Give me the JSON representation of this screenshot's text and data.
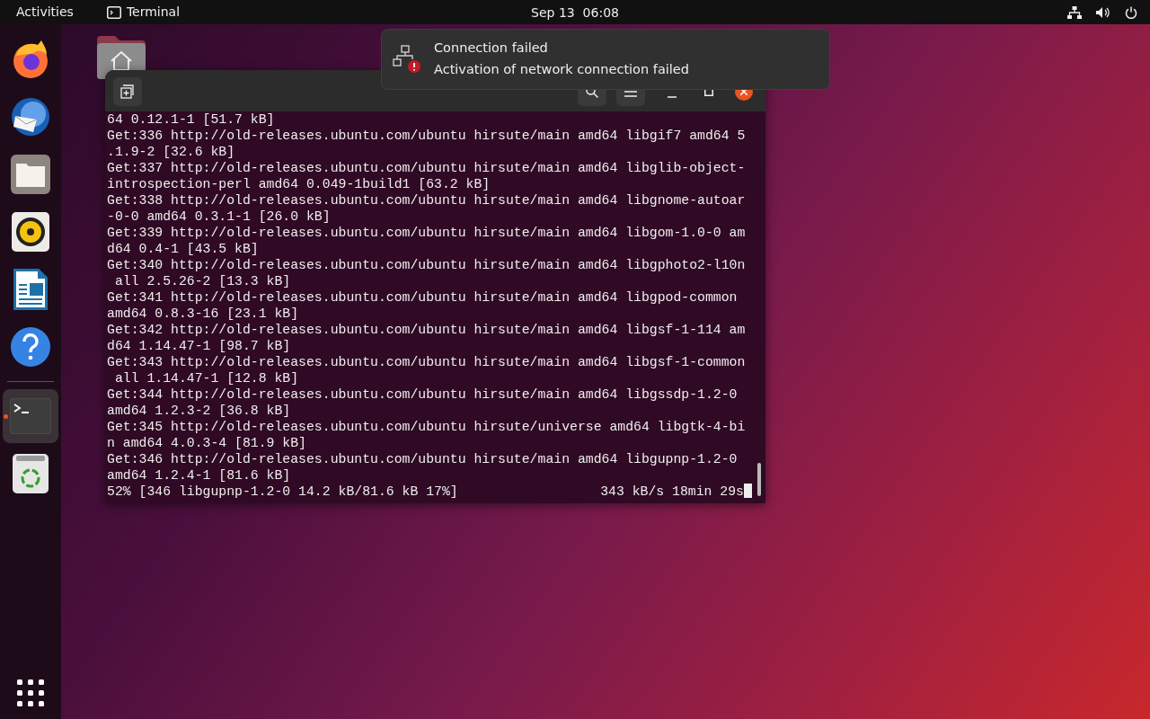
{
  "top_bar": {
    "activities": "Activities",
    "app_name": "Terminal",
    "clock": "Sep 13  06:08"
  },
  "dock": {
    "items": [
      {
        "kind": "browser",
        "running": false
      },
      {
        "kind": "mail",
        "running": false
      },
      {
        "kind": "files",
        "running": false
      },
      {
        "kind": "music",
        "running": false
      },
      {
        "kind": "writer",
        "running": false
      },
      {
        "kind": "help",
        "running": false
      },
      {
        "kind": "terminal",
        "running": true
      },
      {
        "kind": "trash",
        "running": false
      }
    ]
  },
  "notification": {
    "title": "Connection failed",
    "body": "Activation of network connection failed"
  },
  "terminal": {
    "lines": [
      "64 0.12.1-1 [51.7 kB]",
      "Get:336 http://old-releases.ubuntu.com/ubuntu hirsute/main amd64 libgif7 amd64 5",
      ".1.9-2 [32.6 kB]",
      "Get:337 http://old-releases.ubuntu.com/ubuntu hirsute/main amd64 libglib-object-",
      "introspection-perl amd64 0.049-1build1 [63.2 kB]",
      "Get:338 http://old-releases.ubuntu.com/ubuntu hirsute/main amd64 libgnome-autoar",
      "-0-0 amd64 0.3.1-1 [26.0 kB]",
      "Get:339 http://old-releases.ubuntu.com/ubuntu hirsute/main amd64 libgom-1.0-0 am",
      "d64 0.4-1 [43.5 kB]",
      "Get:340 http://old-releases.ubuntu.com/ubuntu hirsute/main amd64 libgphoto2-l10n",
      " all 2.5.26-2 [13.3 kB]",
      "Get:341 http://old-releases.ubuntu.com/ubuntu hirsute/main amd64 libgpod-common",
      "amd64 0.8.3-16 [23.1 kB]",
      "Get:342 http://old-releases.ubuntu.com/ubuntu hirsute/main amd64 libgsf-1-114 am",
      "d64 1.14.47-1 [98.7 kB]",
      "Get:343 http://old-releases.ubuntu.com/ubuntu hirsute/main amd64 libgsf-1-common",
      " all 1.14.47-1 [12.8 kB]",
      "Get:344 http://old-releases.ubuntu.com/ubuntu hirsute/main amd64 libgssdp-1.2-0",
      "amd64 1.2.3-2 [36.8 kB]",
      "Get:345 http://old-releases.ubuntu.com/ubuntu hirsute/universe amd64 libgtk-4-bi",
      "n amd64 4.0.3-4 [81.9 kB]",
      "Get:346 http://old-releases.ubuntu.com/ubuntu hirsute/main amd64 libgupnp-1.2-0",
      "amd64 1.2.4-1 [81.6 kB]"
    ],
    "status_left": "52% [346 libgupnp-1.2-0 14.2 kB/81.6 kB 17%]",
    "status_right": "343 kB/s 18min 29s"
  }
}
